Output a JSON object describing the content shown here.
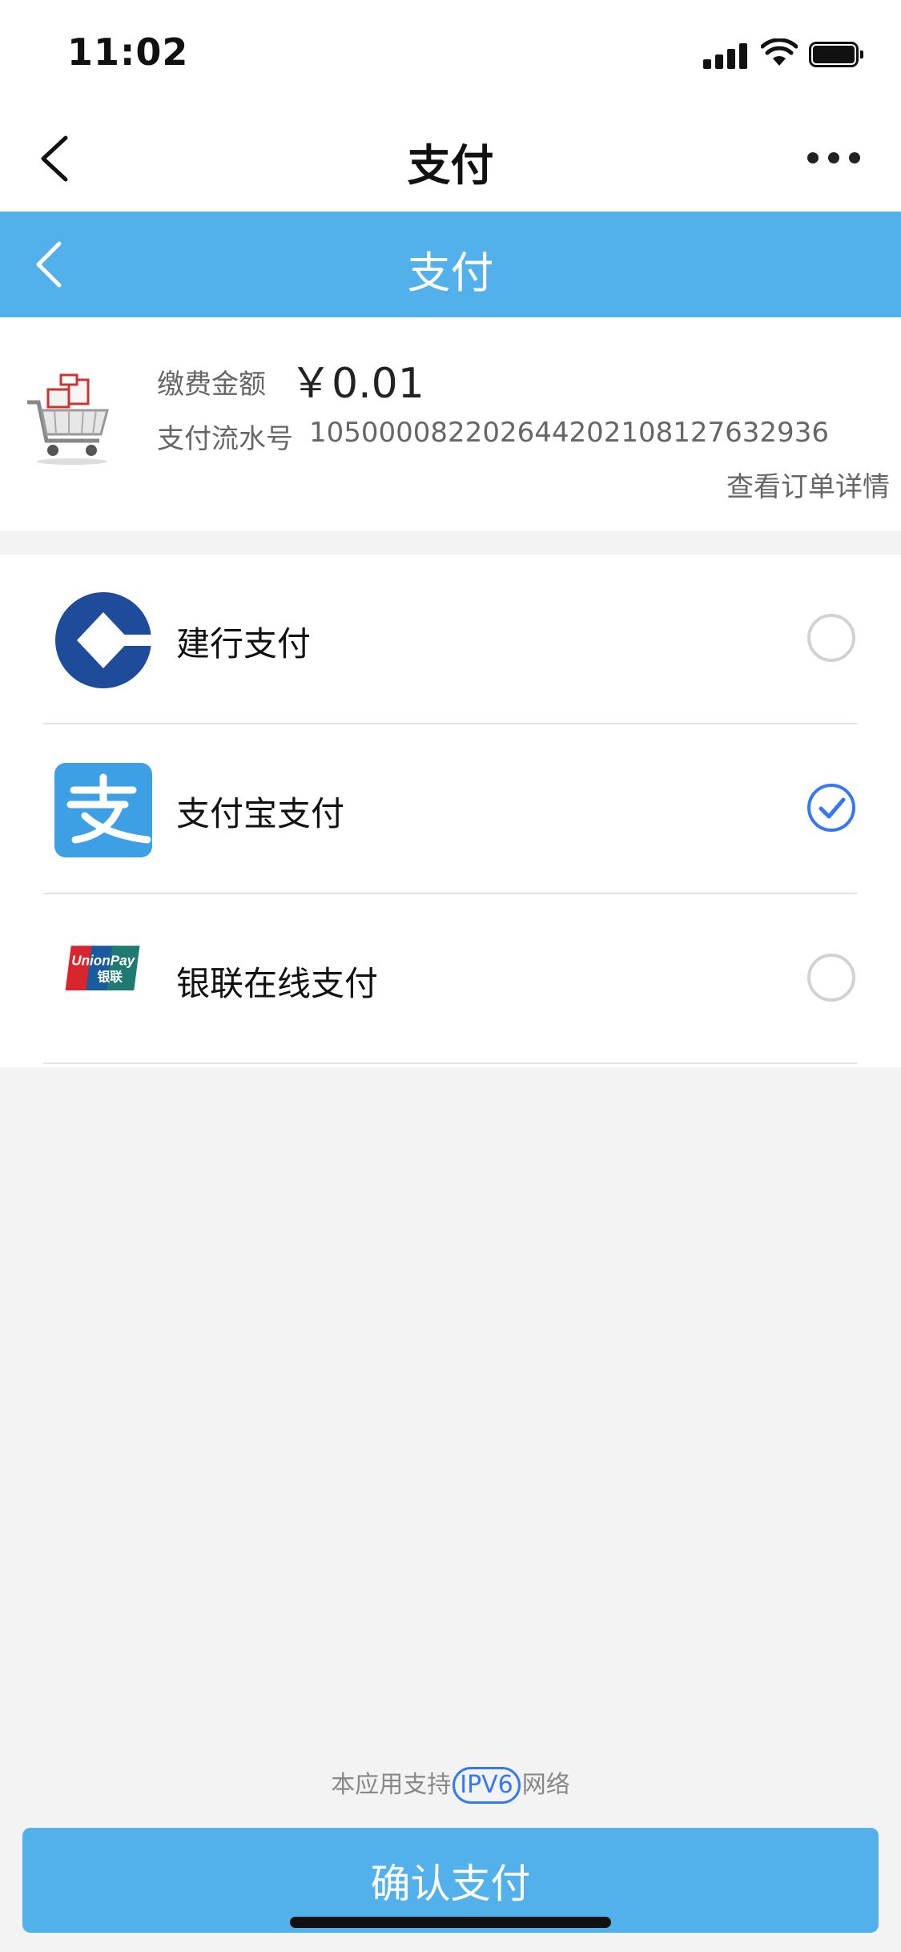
{
  "status_bar": {
    "time": "11:02"
  },
  "nav": {
    "title": "支付"
  },
  "blue_header": {
    "title": "支付"
  },
  "order": {
    "amount_label": "缴费金额",
    "amount_value": "￥0.01",
    "serial_label": "支付流水号",
    "serial_value": "105000082202644202108127632936",
    "detail_link": "查看订单详情"
  },
  "payment_methods": [
    {
      "name": "建行支付",
      "icon": "ccb-logo-icon",
      "selected": false
    },
    {
      "name": "支付宝支付",
      "icon": "alipay-logo-icon",
      "selected": true
    },
    {
      "name": "银联在线支付",
      "icon": "unionpay-logo-icon",
      "selected": false
    }
  ],
  "footer": {
    "ipv6_prefix": "本应用支持",
    "ipv6_badge": "IPV6",
    "ipv6_suffix": "网络",
    "confirm_label": "确认支付"
  },
  "colors": {
    "header_blue": "#52b1ea",
    "check_blue": "#3478f6",
    "ccb_blue": "#1f4c9a",
    "alipay_blue": "#3d9fe4"
  }
}
